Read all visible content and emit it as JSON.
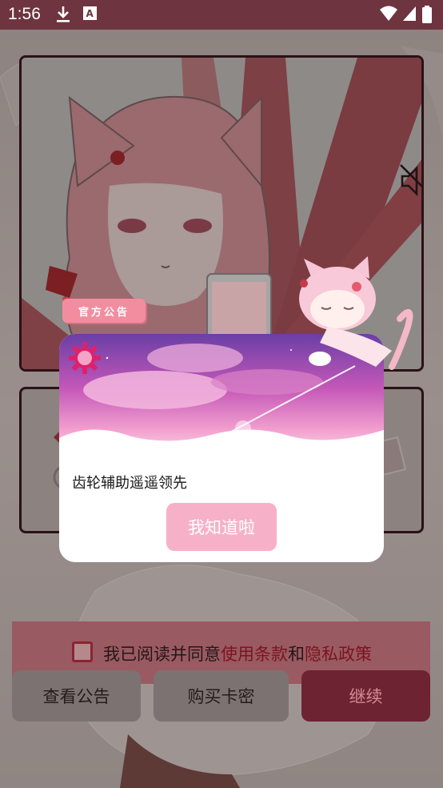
{
  "status_bar": {
    "time": "1:56"
  },
  "dialog": {
    "badge": "官方公告",
    "message": "齿轮辅助遥遥领先",
    "confirm_label": "我知道啦"
  },
  "agreement": {
    "prefix": "我已阅读并同意",
    "terms": "使用条款",
    "and": "和",
    "privacy": "隐私政策"
  },
  "buttons": {
    "view_notice": "查看公告",
    "buy_key": "购买卡密",
    "continue": "继续"
  },
  "colors": {
    "status_bar": "#6e3440",
    "accent": "#6e2332",
    "confirm": "#f6b1c9",
    "gear": "#e0206a"
  },
  "icons": [
    "download-icon",
    "font-a-icon",
    "wifi-icon",
    "cell-signal-icon",
    "battery-icon",
    "mute-icon",
    "gear-icon"
  ]
}
